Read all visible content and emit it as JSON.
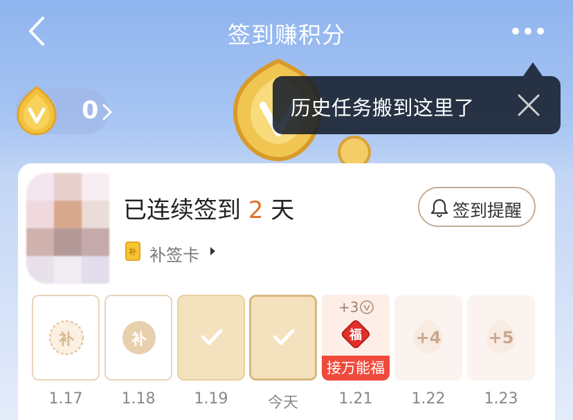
{
  "header": {
    "title": "签到赚积分",
    "back_icon": "back-arrow-icon",
    "more_icon": "more-dots-icon"
  },
  "points": {
    "value": "0",
    "coin_icon": "v-coin-icon"
  },
  "tooltip": {
    "text": "历史任务搬到这里了",
    "close_icon": "close-icon"
  },
  "signin": {
    "streak_prefix": "已连续签到 ",
    "streak_days": "2",
    "streak_suffix": " 天",
    "remind_label": "签到提醒",
    "makeup_card_label": "补签卡",
    "days": [
      {
        "date": "1.17",
        "state": "makeup-outline",
        "badge": "补"
      },
      {
        "date": "1.18",
        "state": "makeup",
        "badge": "补"
      },
      {
        "date": "1.19",
        "state": "checked"
      },
      {
        "date": "今天",
        "state": "today-checked"
      },
      {
        "date": "1.21",
        "state": "bonus",
        "bonus_points": "+3",
        "badge": "福",
        "caption": "接万能福"
      },
      {
        "date": "1.22",
        "state": "future",
        "points": "+4"
      },
      {
        "date": "1.23",
        "state": "future",
        "points": "+5"
      }
    ]
  },
  "colors": {
    "accent": "#e0702a",
    "gold": "#f4e1bd",
    "bonus_red": "#ef4a3b"
  }
}
